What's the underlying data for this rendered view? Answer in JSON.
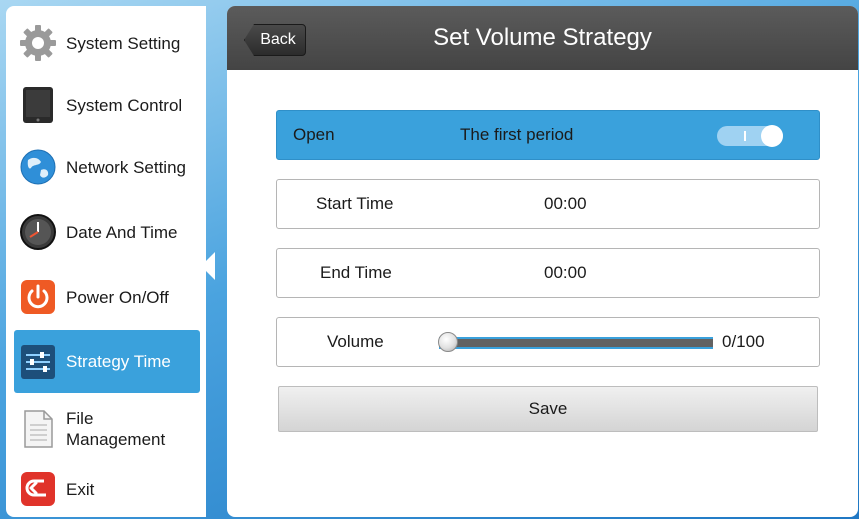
{
  "sidebar": {
    "items": [
      {
        "label": "System Setting",
        "icon": "gear-icon"
      },
      {
        "label": "System Control",
        "icon": "tablet-icon"
      },
      {
        "label": "Network Setting",
        "icon": "globe-icon"
      },
      {
        "label": "Date And Time",
        "icon": "clock-icon"
      },
      {
        "label": "Power On/Off",
        "icon": "power-icon"
      },
      {
        "label": "Strategy Time",
        "icon": "sliders-icon",
        "active": true
      },
      {
        "label": "File Management",
        "label_line1": "File",
        "label_line2": "Management",
        "icon": "document-icon"
      },
      {
        "label": "Exit",
        "icon": "exit-icon"
      }
    ]
  },
  "header": {
    "back_label": "Back",
    "title": "Set Volume Strategy"
  },
  "period_row": {
    "status_label": "Open",
    "period_label": "The first period",
    "toggle_on": true
  },
  "start_time": {
    "label": "Start Time",
    "value": "00:00"
  },
  "end_time": {
    "label": "End Time",
    "value": "00:00"
  },
  "volume": {
    "label": "Volume",
    "value": 0,
    "max": 100,
    "value_text": "0/100"
  },
  "save_label": "Save",
  "colors": {
    "accent": "#3aa1dc",
    "header": "#4f4f4f",
    "exit_red": "#e0332a",
    "power_orange": "#ef5a24"
  }
}
